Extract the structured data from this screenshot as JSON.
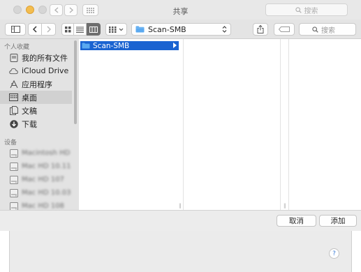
{
  "window": {
    "title": "共享",
    "search_placeholder": "搜索"
  },
  "toolbar": {
    "path_folder": "Scan-SMB",
    "search_placeholder": "搜索"
  },
  "sidebar": {
    "favorites_header": "个人收藏",
    "favorites": [
      {
        "label": "我的所有文件",
        "icon": "all-files-icon"
      },
      {
        "label": "iCloud Drive",
        "icon": "cloud-icon"
      },
      {
        "label": "应用程序",
        "icon": "applications-icon"
      },
      {
        "label": "桌面",
        "icon": "desktop-icon",
        "selected": true
      },
      {
        "label": "文稿",
        "icon": "documents-icon"
      },
      {
        "label": "下载",
        "icon": "download-icon"
      }
    ],
    "devices_header": "设备",
    "devices": [
      {
        "label": "Macintosh HD",
        "icon": "disk-icon"
      },
      {
        "label": "Mac HD 10.11",
        "icon": "disk-icon"
      },
      {
        "label": "Mac HD 107",
        "icon": "disk-icon"
      },
      {
        "label": "Mac HD 10.03",
        "icon": "disk-icon"
      },
      {
        "label": "Mac HD 108",
        "icon": "disk-icon"
      }
    ]
  },
  "browser": {
    "column1_items": [
      {
        "label": "Scan-SMB",
        "selected": true
      }
    ]
  },
  "footer": {
    "cancel_label": "取消",
    "add_label": "添加",
    "help_label": "?"
  },
  "colors": {
    "selection": "#1a63d1",
    "folder": "#5aa9f0"
  }
}
